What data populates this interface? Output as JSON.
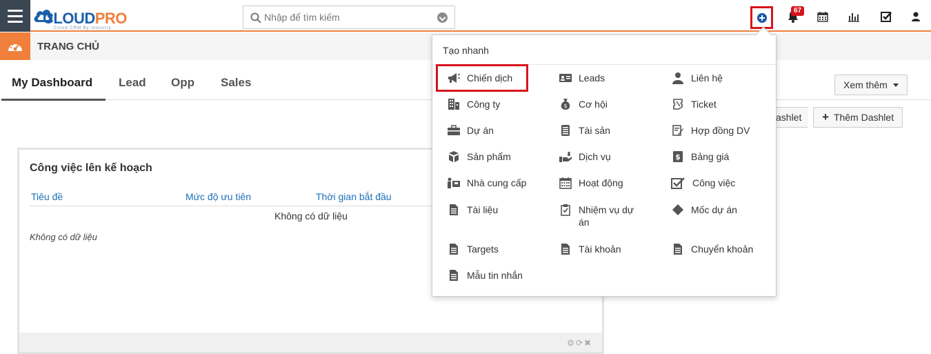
{
  "header": {
    "logo_main": "CLOUD",
    "logo_accent": "PRO",
    "logo_tagline": "Cloud CRM By Industry",
    "search_placeholder": "Nhập để tìm kiếm",
    "notification_count": "67",
    "icons": [
      "menu-icon",
      "search-icon",
      "plus-circle-icon",
      "bell-icon",
      "calendar-icon",
      "chart-icon",
      "checkbox-icon",
      "user-icon"
    ],
    "accent_color": "#f07f3c",
    "brand_color": "#1b5fab"
  },
  "breadcrumb": {
    "title": "TRANG CHỦ"
  },
  "tabs": [
    {
      "label": "My Dashboard",
      "active": true
    },
    {
      "label": "Lead"
    },
    {
      "label": "Opp"
    },
    {
      "label": "Sales"
    }
  ],
  "toolbar": {
    "more_label": "Xem thêm",
    "add_dashlet_partial": "ashlet",
    "add_dashlet_label": "Thêm Dashlet"
  },
  "dashlet": {
    "title": "Công việc lên kế hoạch",
    "columns": [
      "Tiêu đề",
      "Mức độ ưu tiên",
      "Thời gian bắt đầu"
    ],
    "no_data": "Không có dữ liệu",
    "no_data_italic": "Không có dữ liệu"
  },
  "quick_create": {
    "heading": "Tạo nhanh",
    "items": [
      {
        "label": "Chiến dịch",
        "icon": "megaphone-icon"
      },
      {
        "label": "Leads",
        "icon": "id-card-icon"
      },
      {
        "label": "Liên hệ",
        "icon": "person-icon"
      },
      {
        "label": "Công ty",
        "icon": "building-icon"
      },
      {
        "label": "Cơ hội",
        "icon": "money-bag-icon"
      },
      {
        "label": "Ticket",
        "icon": "ticket-icon"
      },
      {
        "label": "Dự án",
        "icon": "briefcase-icon"
      },
      {
        "label": "Tài sản",
        "icon": "barcode-icon"
      },
      {
        "label": "Hợp đồng DV",
        "icon": "contract-icon"
      },
      {
        "label": "Sản phẩm",
        "icon": "cubes-icon"
      },
      {
        "label": "Dịch vụ",
        "icon": "hand-service-icon"
      },
      {
        "label": "Bảng giá",
        "icon": "price-book-icon"
      },
      {
        "label": "Nhà cung cấp",
        "icon": "vendor-icon"
      },
      {
        "label": "Hoạt động",
        "icon": "calendar-grid-icon"
      },
      {
        "label": "Công việc",
        "icon": "check-square-icon"
      },
      {
        "label": "Tài liệu",
        "icon": "document-icon"
      },
      {
        "label": "Nhiệm vụ dự án",
        "icon": "clipboard-check-icon"
      },
      {
        "label": "Mốc dự án",
        "icon": "diamond-icon"
      },
      {
        "label": "Targets",
        "icon": "document-icon"
      },
      {
        "label": "Tài khoản",
        "icon": "document-icon"
      },
      {
        "label": "Chuyển khoản",
        "icon": "document-icon"
      },
      {
        "label": "Mẫu tin nhắn",
        "icon": "document-icon"
      }
    ]
  }
}
